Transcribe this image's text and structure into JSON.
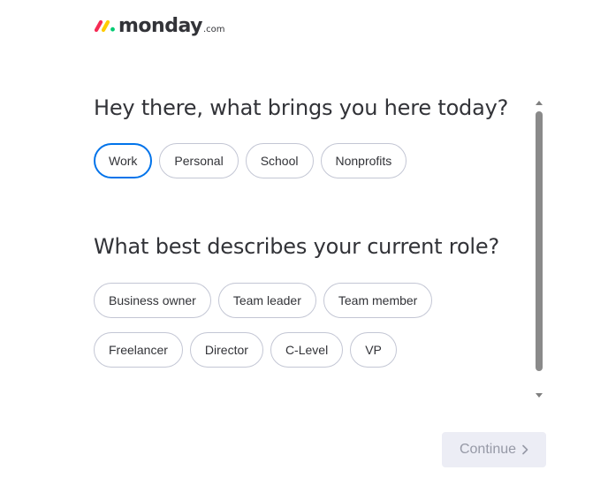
{
  "brand": {
    "name": "monday",
    "tld": ".com",
    "logo_colors": [
      "#f62b54",
      "#ffcc00",
      "#00ca72"
    ]
  },
  "questions": [
    {
      "title": "Hey there, what brings you here today?",
      "options": [
        "Work",
        "Personal",
        "School",
        "Nonprofits"
      ],
      "selected": "Work"
    },
    {
      "title": "What best describes your current role?",
      "options": [
        "Business owner",
        "Team leader",
        "Team member",
        "Freelancer",
        "Director",
        "C-Level",
        "VP"
      ],
      "selected": null
    }
  ],
  "footer": {
    "continue_label": "Continue",
    "continue_icon": "chevron-right-icon",
    "continue_enabled": false
  },
  "colors": {
    "accent": "#0073ea",
    "text": "#323338",
    "chip_border": "#c3c6d4",
    "disabled_bg": "#ecedf5",
    "disabled_text": "#9699a6"
  }
}
